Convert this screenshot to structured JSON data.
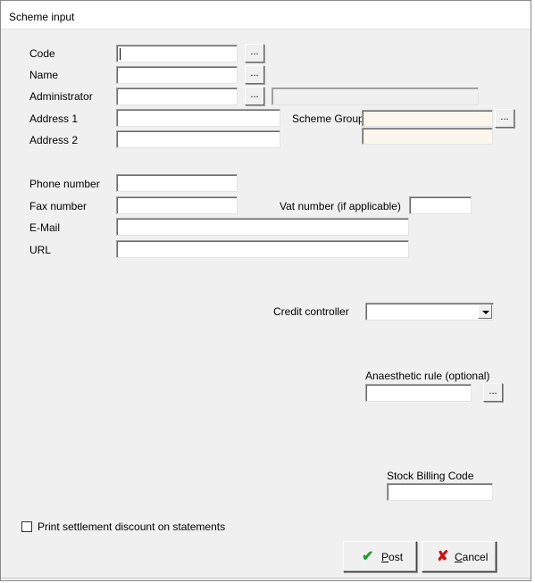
{
  "window": {
    "title": "Scheme input"
  },
  "form": {
    "code": {
      "label": "Code",
      "value": "",
      "lookup_label": "..."
    },
    "name": {
      "label": "Name",
      "value": "",
      "lookup_label": "..."
    },
    "administrator": {
      "label": "Administrator",
      "value": "",
      "lookup_label": "...",
      "display_value": ""
    },
    "address1": {
      "label": "Address 1",
      "value": ""
    },
    "address2": {
      "label": "Address 2",
      "value": ""
    },
    "scheme_group": {
      "label": "Scheme Group",
      "value": "",
      "value2": "",
      "lookup_label": "..."
    },
    "phone": {
      "label": "Phone number",
      "value": ""
    },
    "fax": {
      "label": "Fax number",
      "value": ""
    },
    "vat": {
      "label": "Vat number (if applicable)",
      "value": ""
    },
    "email": {
      "label": "E-Mail",
      "value": ""
    },
    "url": {
      "label": "URL",
      "value": ""
    },
    "credit_controller": {
      "label": "Credit controller",
      "selected": ""
    },
    "anaesthetic_rule": {
      "label": "Anaesthetic rule (optional)",
      "value": "",
      "lookup_label": "..."
    },
    "stock_billing_code": {
      "label": "Stock Billing Code",
      "value": ""
    },
    "print_settlement": {
      "label": "Print settlement discount on statements",
      "checked": false
    }
  },
  "buttons": {
    "post": {
      "accel": "P",
      "rest": "ost",
      "icon": "check-icon"
    },
    "cancel": {
      "accel": "C",
      "rest": "ancel",
      "icon": "x-icon"
    }
  }
}
